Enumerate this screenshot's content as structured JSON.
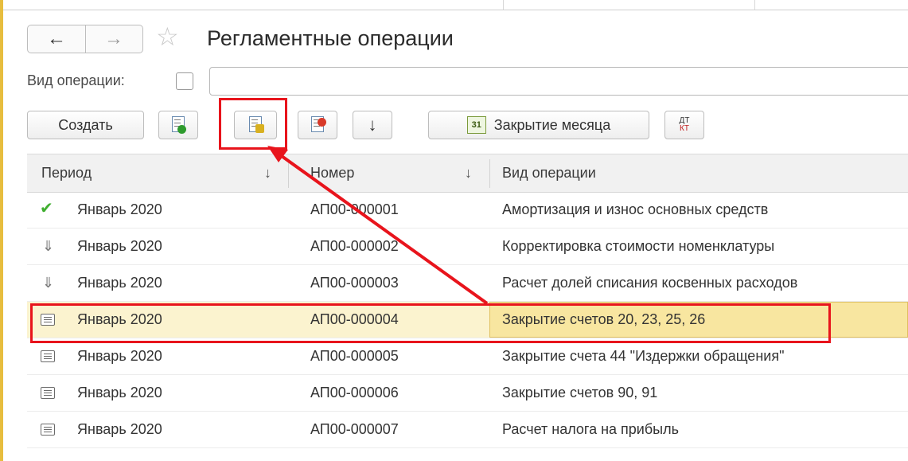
{
  "window": {
    "title": "Регламентные операции",
    "nav": {
      "back": "←",
      "forward": "→"
    },
    "star": "☆"
  },
  "filter": {
    "label": "Вид операции:",
    "value": ""
  },
  "toolbar": {
    "create_label": "Создать",
    "add_icon": "document-add-icon",
    "perform_icon": "document-perform-icon",
    "cancel_icon": "document-cancel-icon",
    "move_down": "↓",
    "month_close_label": "Закрытие месяца",
    "cal_text": "31",
    "dt": "ДТ",
    "kt": "КТ"
  },
  "table": {
    "columns": {
      "period": "Период",
      "number": "Номер",
      "operation": "Вид операции",
      "sort": "↓"
    },
    "rows": [
      {
        "status": "check",
        "period": "Январь 2020",
        "number": "АП00-000001",
        "operation": "Амортизация и износ основных средств"
      },
      {
        "status": "down",
        "period": "Январь 2020",
        "number": "АП00-000002",
        "operation": "Корректировка стоимости номенклатуры"
      },
      {
        "status": "down",
        "period": "Январь 2020",
        "number": "АП00-000003",
        "operation": "Расчет долей списания косвенных расходов"
      },
      {
        "status": "list",
        "period": "Январь 2020",
        "number": "АП00-000004",
        "operation": "Закрытие счетов 20, 23, 25, 26"
      },
      {
        "status": "list",
        "period": "Январь 2020",
        "number": "АП00-000005",
        "operation": "Закрытие счета 44 \"Издержки обращения\""
      },
      {
        "status": "list",
        "period": "Январь 2020",
        "number": "АП00-000006",
        "operation": "Закрытие счетов 90, 91"
      },
      {
        "status": "list",
        "period": "Январь 2020",
        "number": "АП00-000007",
        "operation": "Расчет налога на прибыль"
      }
    ],
    "selected_row": 3
  },
  "colors": {
    "accent": "#e7bd3e",
    "highlight": "#e8141c",
    "selected_row": "#fbf3cf",
    "check": "#3fae2f"
  }
}
